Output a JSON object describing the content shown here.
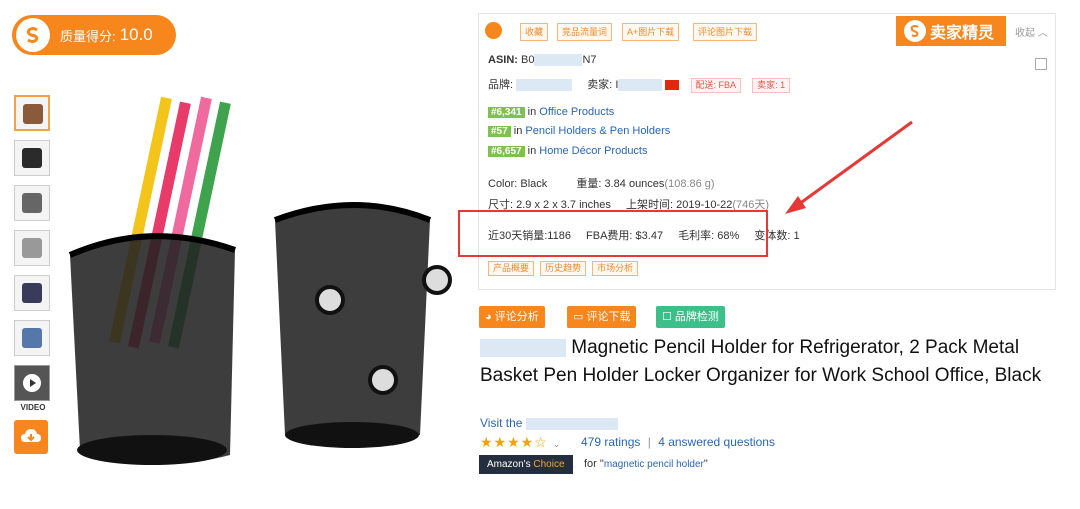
{
  "score_badge": {
    "label": "质量得分:",
    "value": "10.0"
  },
  "thumbnails": {
    "video_label": "VIDEO"
  },
  "toolbar": {
    "buttons": [
      "收藏",
      "竞品流量词",
      "A+图片下载",
      "评论图片下载"
    ],
    "brand": "卖家精灵",
    "collapse": "收起 ︿"
  },
  "info": {
    "asin_label": "ASIN:",
    "asin_prefix": "B0",
    "asin_suffix": "N7",
    "brand_label": "品牌:",
    "seller_label": "卖家:",
    "seller_prefix": "I",
    "fulfillment": "配送: FBA",
    "sellers": "卖家: 1",
    "ranks": [
      {
        "num": "#6,341",
        "in": "in",
        "category": "Office Products"
      },
      {
        "num": "#57",
        "in": "in",
        "category": "Pencil Holders & Pen Holders"
      },
      {
        "num": "#6,657",
        "in": "in",
        "category": "Home Décor Products"
      }
    ],
    "color": "Color: Black",
    "weight_label": "重量:",
    "weight_value": "3.84 ounces",
    "weight_grams": "(108.86 g)",
    "size_label": "尺寸:",
    "size_value": "2.9 x 2 x 3.7 inches",
    "listed_label": "上架时间:",
    "listed_value": "2019-10-22",
    "listed_days": "(746天)",
    "sales_label": "近30天销量:",
    "sales_value": "1186",
    "fba_label": "FBA费用:",
    "fba_value": "$3.47",
    "margin_label": "毛利率:",
    "margin_value": "68%",
    "variants_label": "变体数:",
    "variants_value": "1",
    "sub_tabs": [
      "产品概要",
      "历史趋势",
      "市场分析"
    ]
  },
  "actions": {
    "review_analysis": "评论分析",
    "review_download": "评论下载",
    "brand_check": "品牌检测"
  },
  "product": {
    "title_tail": "Magnetic Pencil Holder for Refrigerator, 2 Pack Metal Basket Pen Holder Locker Organizer for Work School Office, Black",
    "visit": "Visit the",
    "stars": "★★★★☆",
    "ratings": "479 ratings",
    "separator": "|",
    "questions": "4 answered questions",
    "choice_prefix": "Amazon's",
    "choice_word": "Choice",
    "choice_for": "for \"",
    "choice_keyword": "magnetic pencil holder",
    "choice_close": "\""
  },
  "colors": {
    "accent": "#f7861c",
    "highlight_box": "#e53935",
    "link": "#2a66b3",
    "rank_green": "#7dc24d"
  },
  "icons": [
    "sellersprite-logo",
    "download-cloud-icon",
    "video-play-icon",
    "arrow-annotation"
  ]
}
